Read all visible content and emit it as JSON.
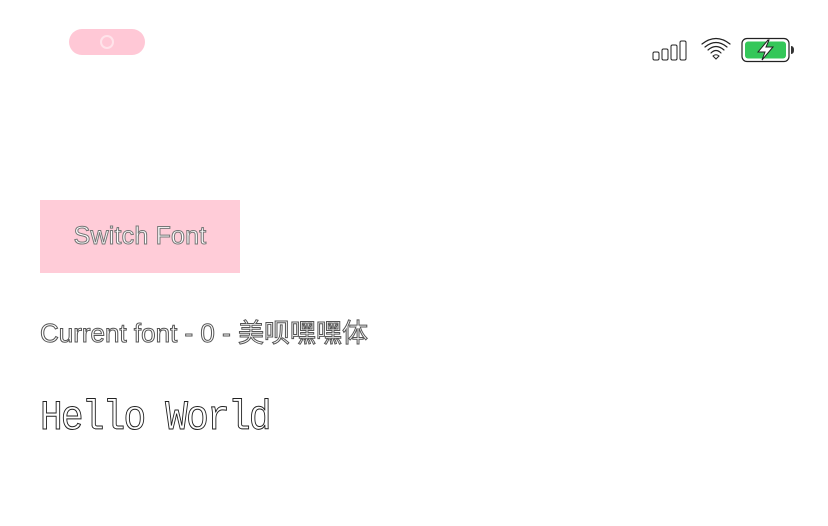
{
  "status_bar": {
    "camera_indicator_icon": "camera-indicator-icon",
    "signal_icon": "cellular-signal-icon",
    "wifi_icon": "wifi-icon",
    "battery_icon": "battery-charging-icon",
    "pill_color": "#ffc8d6",
    "battery_color": "#34c759"
  },
  "main": {
    "switch_button_label": "Switch Font",
    "current_font_label": "Current font - 0 - 美呗嘿嘿体",
    "preview_text": "Hello World",
    "button_color": "#ffccd8"
  }
}
